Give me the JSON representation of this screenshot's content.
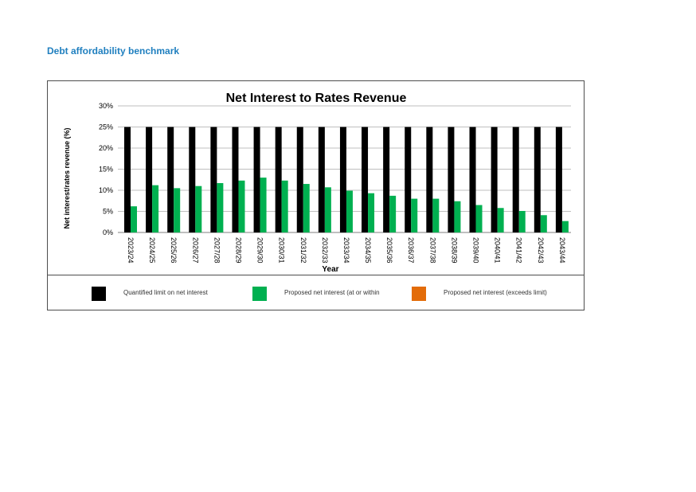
{
  "page": {
    "heading": "Debt affordability benchmark"
  },
  "chart_data": {
    "type": "bar",
    "title": "Net Interest to Rates Revenue",
    "xlabel": "Year",
    "ylabel": "Net interest/rates revenue (%)",
    "ylim": [
      0,
      30
    ],
    "yticks": [
      0,
      5,
      10,
      15,
      20,
      25,
      30
    ],
    "ytick_labels": [
      "0%",
      "5%",
      "10%",
      "15%",
      "20%",
      "25%",
      "30%"
    ],
    "grid": true,
    "legend_position": "bottom",
    "categories": [
      "2023/24",
      "2024/25",
      "2025/26",
      "2026/27",
      "2027/28",
      "2028/29",
      "2029/30",
      "2030/31",
      "2031/32",
      "2032/33",
      "2033/34",
      "2034/35",
      "2035/36",
      "2036/37",
      "2037/38",
      "2038/39",
      "2039/40",
      "2040/41",
      "2041/42",
      "2042/43",
      "2043/44"
    ],
    "series": [
      {
        "name": "Quantified limit on net interest",
        "color": "#000000",
        "values": [
          25,
          25,
          25,
          25,
          25,
          25,
          25,
          25,
          25,
          25,
          25,
          25,
          25,
          25,
          25,
          25,
          25,
          25,
          25,
          25,
          25
        ]
      },
      {
        "name": "Proposed net interest (at or within",
        "color": "#00b050",
        "values": [
          6.2,
          11.2,
          10.5,
          11.0,
          11.7,
          12.3,
          13.0,
          12.3,
          11.5,
          10.7,
          9.9,
          9.3,
          8.7,
          8.0,
          8.0,
          7.4,
          6.5,
          5.8,
          5.1,
          4.1,
          2.7
        ]
      },
      {
        "name": "Proposed net interest (exceeds limit)",
        "color": "#e36c09",
        "values": [
          0,
          0,
          0,
          0,
          0,
          0,
          0,
          0,
          0,
          0,
          0,
          0,
          0,
          0,
          0,
          0,
          0,
          0,
          0,
          0,
          0
        ]
      }
    ]
  }
}
